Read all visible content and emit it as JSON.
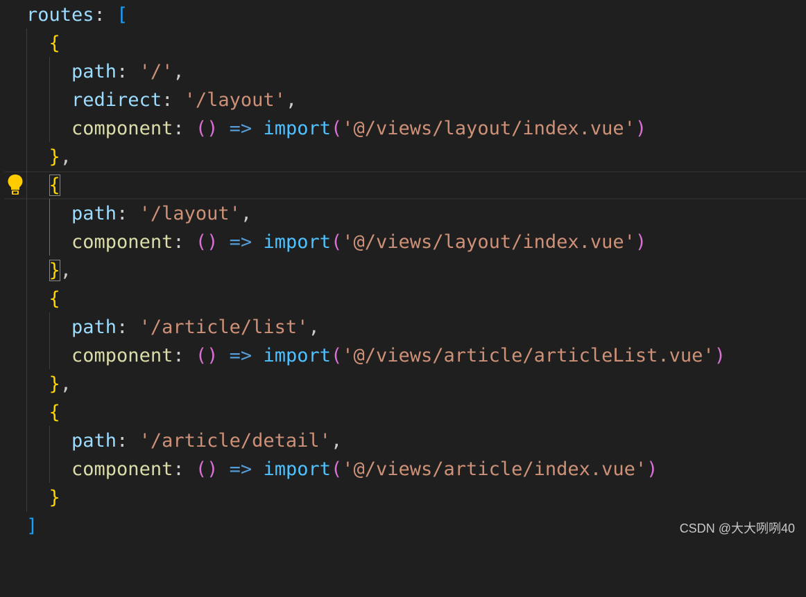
{
  "editor": {
    "theme_colors": {
      "background": "#1f1f1f",
      "property": "#9cdcfe",
      "string": "#ce9178",
      "function_key": "#dcdcaa",
      "import_keyword": "#4fc1ff",
      "arrow_operator": "#569cd6",
      "bracket_level1": "#ffd700",
      "bracket_level2": "#da70d6",
      "bracket_level3": "#179fff"
    },
    "lines": {
      "l1": {
        "key": "routes",
        "colon": ":",
        "open": "["
      },
      "l2": {
        "open": "{"
      },
      "l3": {
        "key": "path",
        "colon": ":",
        "value": "'/'",
        "comma": ","
      },
      "l4": {
        "key": "redirect",
        "colon": ":",
        "value": "'/layout'",
        "comma": ","
      },
      "l5": {
        "key": "component",
        "colon": ":",
        "parens": "()",
        "arrow": "=>",
        "keyword": "import",
        "open": "(",
        "value": "'@/views/layout/index.vue'",
        "close": ")"
      },
      "l6": {
        "close": "}",
        "comma": ","
      },
      "l7": {
        "open": "{"
      },
      "l8": {
        "key": "path",
        "colon": ":",
        "value": "'/layout'",
        "comma": ","
      },
      "l9": {
        "key": "component",
        "colon": ":",
        "parens": "()",
        "arrow": "=>",
        "keyword": "import",
        "open": "(",
        "value": "'@/views/layout/index.vue'",
        "close": ")"
      },
      "l10": {
        "close": "}",
        "comma": ","
      },
      "l11": {
        "open": "{"
      },
      "l12": {
        "key": "path",
        "colon": ":",
        "value": "'/article/list'",
        "comma": ","
      },
      "l13": {
        "key": "component",
        "colon": ":",
        "parens": "()",
        "arrow": "=>",
        "keyword": "import",
        "open": "(",
        "value": "'@/views/article/articleList.vue'",
        "close": ")"
      },
      "l14": {
        "close": "}",
        "comma": ","
      },
      "l15": {
        "open": "{"
      },
      "l16": {
        "key": "path",
        "colon": ":",
        "value": "'/article/detail'",
        "comma": ","
      },
      "l17": {
        "key": "component",
        "colon": ":",
        "parens": "()",
        "arrow": "=>",
        "keyword": "import",
        "open": "(",
        "value": "'@/views/article/index.vue'",
        "close": ")"
      },
      "l18": {
        "close": "}"
      },
      "l19": {
        "close": "]"
      }
    },
    "lightbulb_icon": "lightbulb-icon"
  },
  "watermark": {
    "text": "CSDN @大大咧咧40"
  }
}
